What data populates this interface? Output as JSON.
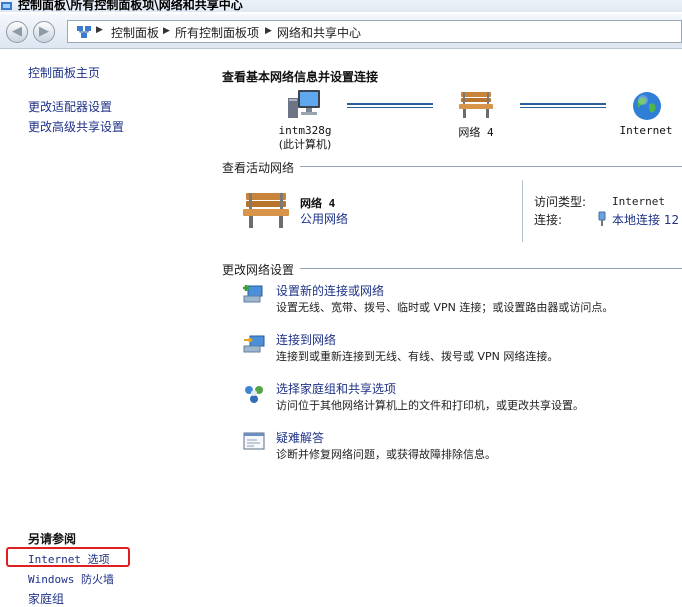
{
  "window": {
    "title": "控制面板\\所有控制面板项\\网络和共享中心"
  },
  "address": {
    "crumbs": [
      "控制面板",
      "所有控制面板项",
      "网络和共享中心"
    ]
  },
  "sidebar": {
    "home": "控制面板主页",
    "adapter": "更改适配器设置",
    "advanced": "更改高级共享设置",
    "see_also_title": "另请参阅",
    "see_also": [
      "Internet 选项",
      "Windows 防火墙",
      "家庭组"
    ]
  },
  "main": {
    "heading": "查看基本网络信息并设置连接",
    "map": {
      "computer_name": "intm328g",
      "computer_sub": "(此计算机)",
      "network_label": "网络  4",
      "internet_label": "Internet"
    },
    "active_title": "查看活动网络",
    "active": {
      "name": "网络  4",
      "type": "公用网络",
      "access_label": "访问类型:",
      "access_value": "Internet",
      "conn_label": "连接:",
      "conn_value": "本地连接 12"
    },
    "change_title": "更改网络设置",
    "tasks": [
      {
        "title": "设置新的连接或网络",
        "desc": "设置无线、宽带、拨号、临时或 VPN 连接；或设置路由器或访问点。"
      },
      {
        "title": "连接到网络",
        "desc": "连接到或重新连接到无线、有线、拨号或 VPN 网络连接。"
      },
      {
        "title": "选择家庭组和共享选项",
        "desc": "访问位于其他网络计算机上的文件和打印机，或更改共享设置。"
      },
      {
        "title": "疑难解答",
        "desc": "诊断并修复网络问题，或获得故障排除信息。"
      }
    ]
  }
}
